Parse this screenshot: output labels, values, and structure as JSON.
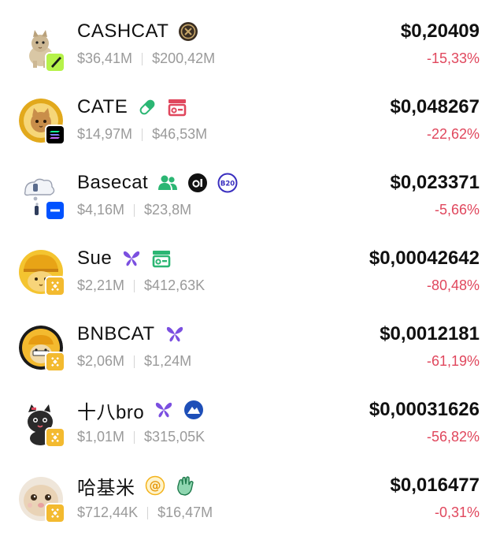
{
  "colors": {
    "price": "#111111",
    "change_negative": "#e0475d",
    "meta_text": "#9a9a9a",
    "bnb_chain": "#f3ba2f",
    "solana_chain": "#000000",
    "base_chain": "#0052ff",
    "pump_chain": "#b6f24a"
  },
  "tokens": [
    {
      "name": "CASHCAT",
      "volume": "$36,41M",
      "market_cap": "$200,42M",
      "price": "$0,20409",
      "change": "-15,33%",
      "chain_icon": "pump-chain-icon",
      "tags": [
        "coin-badge-icon"
      ]
    },
    {
      "name": "CATE",
      "volume": "$14,97M",
      "market_cap": "$46,53M",
      "price": "$0,048267",
      "change": "-22,62%",
      "chain_icon": "solana-chain-icon",
      "tags": [
        "pill-icon",
        "launchpad-icon"
      ]
    },
    {
      "name": "Basecat",
      "volume": "$4,16M",
      "market_cap": "$23,8M",
      "price": "$0,023371",
      "change": "-5,66%",
      "chain_icon": "base-chain-icon",
      "tags": [
        "community-icon",
        "a1-badge-icon",
        "b20-badge-icon"
      ]
    },
    {
      "name": "Sue",
      "volume": "$2,21M",
      "market_cap": "$412,63K",
      "price": "$0,00042642",
      "change": "-80,48%",
      "chain_icon": "bnb-chain-icon",
      "tags": [
        "butterfly-icon",
        "launchpad-icon"
      ]
    },
    {
      "name": "BNBCAT",
      "volume": "$2,06M",
      "market_cap": "$1,24M",
      "price": "$0,0012181",
      "change": "-61,19%",
      "chain_icon": "bnb-chain-icon",
      "tags": [
        "butterfly-icon"
      ]
    },
    {
      "name": "十八bro",
      "volume": "$1,01M",
      "market_cap": "$315,05K",
      "price": "$0,00031626",
      "change": "-56,82%",
      "chain_icon": "bnb-chain-icon",
      "tags": [
        "butterfly-icon",
        "mountain-badge-icon"
      ]
    },
    {
      "name": "哈基米",
      "volume": "$712,44K",
      "market_cap": "$16,47M",
      "price": "$0,016477",
      "change": "-0,31%",
      "chain_icon": "bnb-chain-icon",
      "tags": [
        "at-sign-icon",
        "waving-hand-icon"
      ]
    }
  ]
}
